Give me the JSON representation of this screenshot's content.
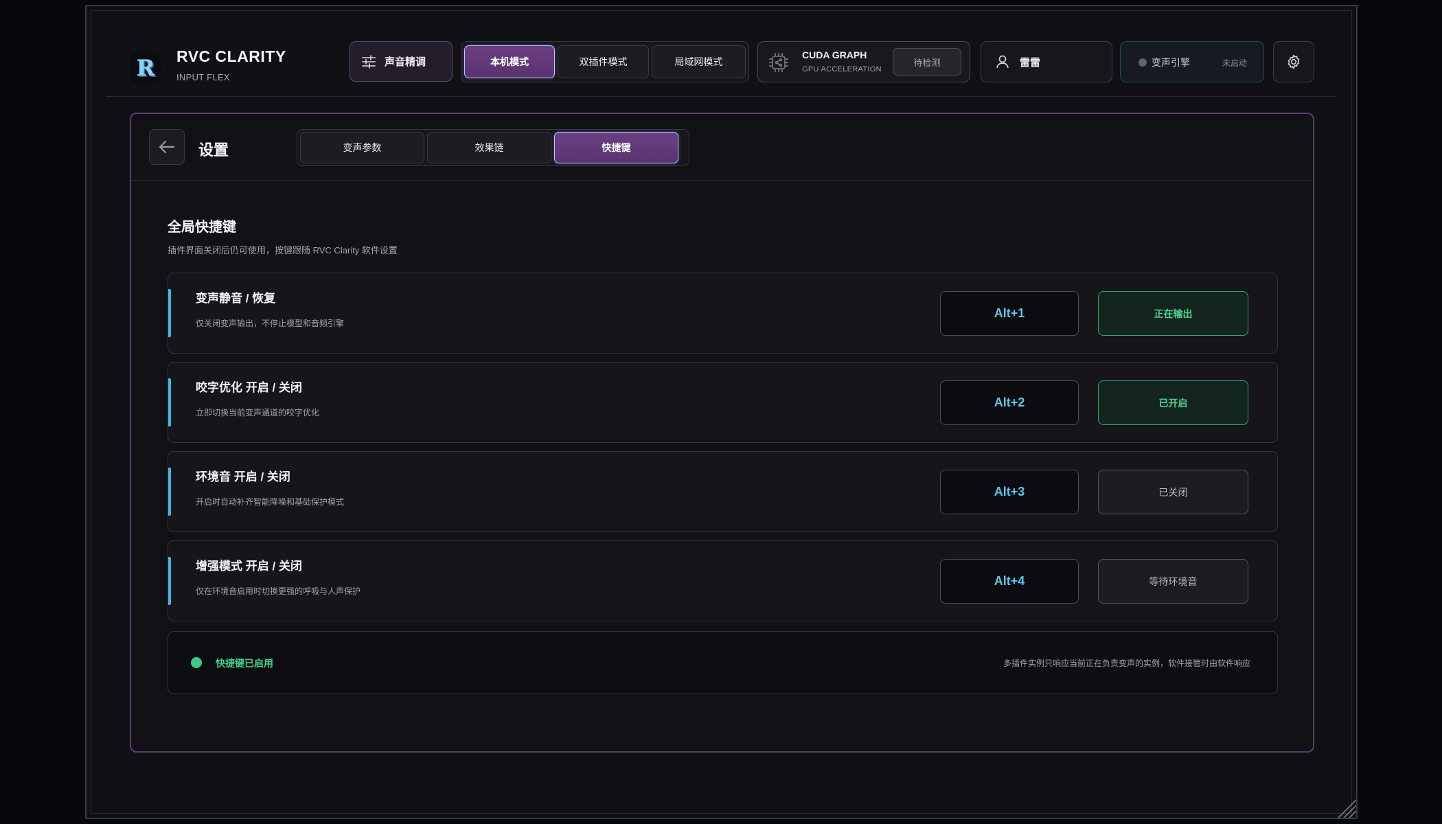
{
  "colors": {
    "accent_purple": "#6b3f82",
    "accent_cyan": "#57c9ec",
    "accent_green": "#3ec98a",
    "panel_border": "#5c3c6e"
  },
  "header": {
    "logo_letter": "R",
    "app_title": "RVC CLARITY",
    "app_subtitle": "INPUT FLEX",
    "tune_button": {
      "label": "声音精调",
      "icon": "sliders-icon"
    },
    "modes": [
      {
        "label": "本机模式",
        "active": true
      },
      {
        "label": "双插件模式",
        "active": false
      },
      {
        "label": "局域网模式",
        "active": false
      }
    ],
    "cuda": {
      "title": "CUDA GRAPH",
      "subtitle": "GPU ACCELERATION",
      "detect_label": "待检测",
      "icon": "chip-icon"
    },
    "user": {
      "name": "雷雷",
      "icon": "user-icon"
    },
    "engine": {
      "label": "变声引擎",
      "status": "未启动"
    },
    "settings_icon": "gear-icon"
  },
  "panel": {
    "title": "设置",
    "back_icon": "arrow-left-icon",
    "tabs": [
      {
        "label": "变声参数",
        "active": false
      },
      {
        "label": "效果链",
        "active": false
      },
      {
        "label": "快捷键",
        "active": true
      }
    ],
    "section_title": "全局快捷键",
    "section_subtitle": "插件界面关闭后仍可使用，按键跟随 RVC Clarity 软件设置",
    "hotkeys": [
      {
        "title": "变声静音 / 恢复",
        "desc": "仅关闭变声输出，不停止模型和音频引擎",
        "key": "Alt+1",
        "state": "正在输出",
        "state_on": true
      },
      {
        "title": "咬字优化 开启 / 关闭",
        "desc": "立即切换当前变声通道的咬字优化",
        "key": "Alt+2",
        "state": "已开启",
        "state_on": true
      },
      {
        "title": "环境音 开启 / 关闭",
        "desc": "开启时自动补齐智能降噪和基础保护模式",
        "key": "Alt+3",
        "state": "已关闭",
        "state_on": false
      },
      {
        "title": "增强模式 开启 / 关闭",
        "desc": "仅在环境音启用时切换更强的呼吸与人声保护",
        "key": "Alt+4",
        "state": "等待环境音",
        "state_on": false
      }
    ],
    "status": {
      "text": "快捷键已启用",
      "note": "多插件实例只响应当前正在负责变声的实例，软件接管时由软件响应"
    }
  }
}
